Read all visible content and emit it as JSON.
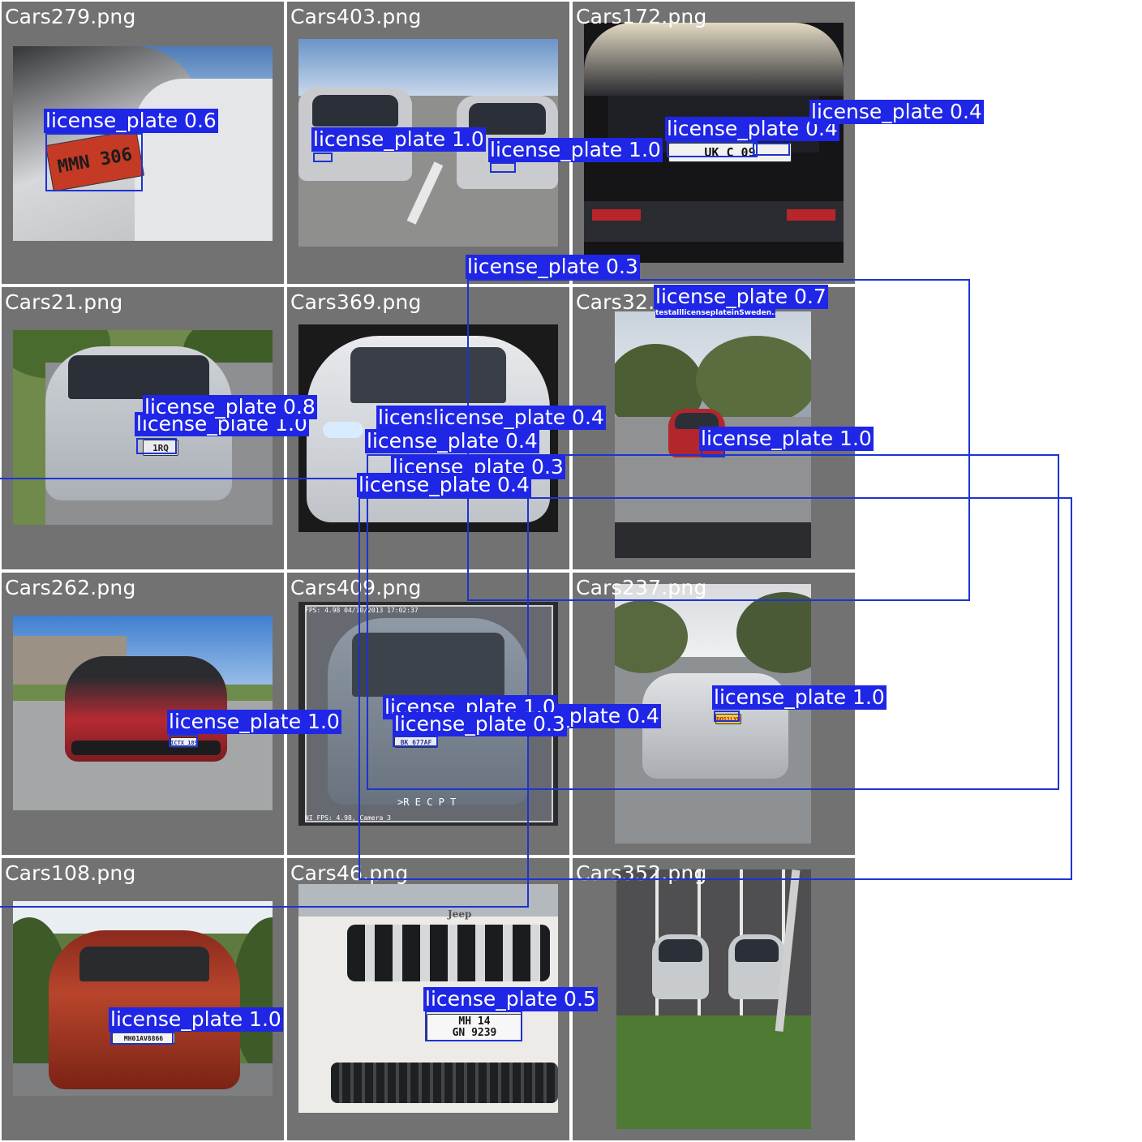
{
  "tiles": [
    {
      "name": "Cars279.png"
    },
    {
      "name": "Cars403.png"
    },
    {
      "name": "Cars172.png"
    },
    {
      "name": "Cars21.png"
    },
    {
      "name": "Cars369.png"
    },
    {
      "name": "Cars32.png"
    },
    {
      "name": "Cars262.png"
    },
    {
      "name": "Cars409.png"
    },
    {
      "name": "Cars237.png"
    },
    {
      "name": "Cars108.png"
    },
    {
      "name": "Cars46.png"
    },
    {
      "name": "Cars352.png"
    }
  ],
  "labels": {
    "l279": "license_plate 0.6",
    "l403a": "license_plate 1.0",
    "l403b": "license_plate 1.0",
    "l172a": "license_plate 0.4",
    "l172b": "license_plate 0.4",
    "l_long_03": "license_plate 0.3",
    "l32a": "license_plate 0.7",
    "l21a": "license_plate 0.8",
    "l21b": "license_plate 1.0",
    "l369a": "license_plate 0.4",
    "l369b": "license_plate 0.4",
    "l369c": "license_plate 0.4",
    "l369d": "license_plate 0.3",
    "l369e": "license_plate 0.4",
    "l32b": "license_plate 1.0",
    "l262": "license_plate 1.0",
    "l409a": "license_plate 1.0",
    "l409b": "license_plate 0.3",
    "l409c": "license_plate 0.4",
    "l237": "license_plate 1.0",
    "l108": "license_plate 1.0",
    "l46": "license_plate 0.5"
  },
  "plates": {
    "p279": "MMN 306",
    "p172": "UK C 09",
    "p21": "1RQ",
    "p262": "ICTX 189",
    "p409": "BK 677AF",
    "p237": "DOS1LYN",
    "p108": "MH01AV8866",
    "p46a": "MH 14",
    "p46b": "GN  9239"
  },
  "misc": {
    "sign32": "testalllicenseplateinSweden...",
    "hud409top": "FPS: 4.98 04/10/2013 17:02:37",
    "hud409bottom": "NI FPS: 4.98, Camera 3",
    "receipt409": ">R E C P T",
    "jeep46": "Jeep"
  }
}
